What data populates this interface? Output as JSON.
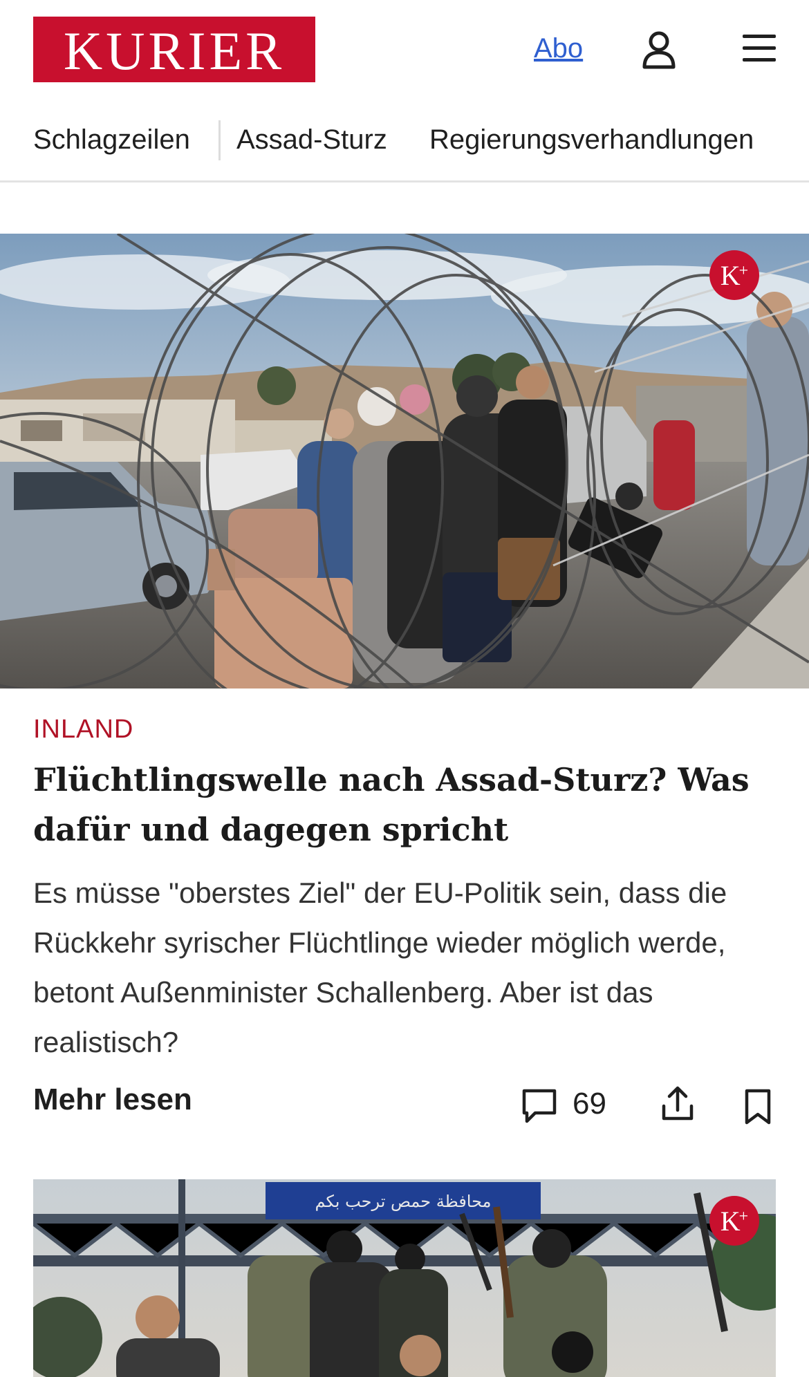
{
  "header": {
    "logo_text": "KURIER",
    "abo_label": "Abo",
    "brand_color": "#c8102e",
    "link_color": "#2f5fd0"
  },
  "nav": {
    "items": [
      {
        "label": "Schlagzeilen"
      },
      {
        "label": "Assad-Sturz"
      },
      {
        "label": "Regierungsverhandlungen"
      }
    ]
  },
  "article": {
    "premium_badge": "K",
    "kicker": "INLAND",
    "kicker_color": "#b01226",
    "headline": "Flüchtlingswelle nach Assad-Sturz? Was dafür und dagegen spricht",
    "teaser": "Es müsse \"oberstes Ziel\" der EU-Politik sein, dass die Rückkehr syrischer Flüchtlinge wieder möglich werde, betont Außenminister Schallenberg. Aber ist das realistisch?",
    "more_label": "Mehr lesen",
    "comment_count": "69"
  },
  "second_article": {
    "premium_badge": "K",
    "sign_text": "محافظة حمص ترحب بكم"
  },
  "icons": {
    "user": "user-icon",
    "menu": "hamburger-menu-icon",
    "comment": "comment-icon",
    "share": "share-icon",
    "bookmark": "bookmark-icon",
    "premium": "kurier-plus-icon"
  }
}
